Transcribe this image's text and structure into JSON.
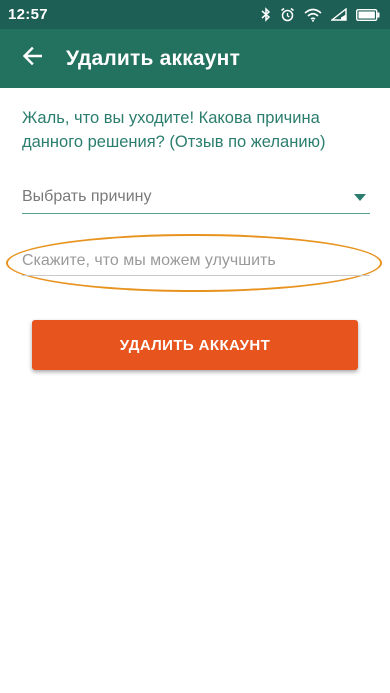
{
  "status_bar": {
    "time": "12:57",
    "icons": [
      "bluetooth-icon",
      "alarm-icon",
      "wifi-icon",
      "signal-icon",
      "battery-icon"
    ]
  },
  "app_bar": {
    "title": "Удалить аккаунт",
    "back_icon": "arrow-back-icon"
  },
  "form": {
    "prompt": "Жаль, что вы уходите! Какова причина данного решения? (Отзыв по желанию)",
    "reason_select": {
      "value": "Выбрать причину"
    },
    "feedback_input": {
      "placeholder": "Скажите, что мы можем улучшить",
      "value": ""
    },
    "delete_button_label": "УДАЛИТЬ АККАУНТ"
  },
  "colors": {
    "status_bar": "#1d5f55",
    "app_bar": "#22725f",
    "prompt_text": "#2b7d6e",
    "accent": "#2b7d6e",
    "highlight": "#e8931e",
    "delete_button": "#e8541d"
  }
}
